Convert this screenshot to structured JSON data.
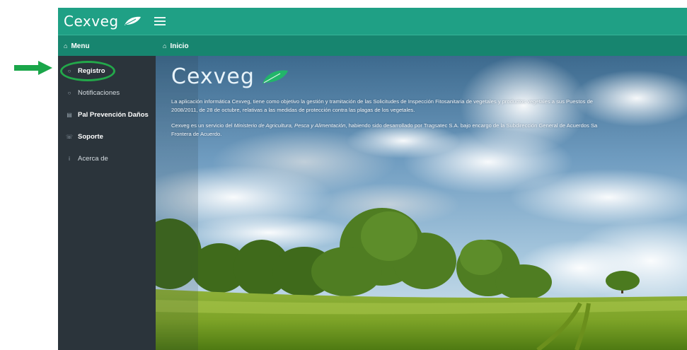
{
  "app": {
    "brand": "Cexveg"
  },
  "subbar": {
    "left_label": "Menu",
    "right_label": "Inicio"
  },
  "sidebar": {
    "items": [
      {
        "label": "Registro",
        "icon": "circle-icon",
        "active": true
      },
      {
        "label": "Notificaciones",
        "icon": "circle-icon"
      },
      {
        "label": "Pal Prevención Daños",
        "icon": "chart-icon"
      },
      {
        "label": "Soporte",
        "icon": "phone-icon"
      },
      {
        "label": "Acerca de",
        "icon": "info-icon"
      }
    ]
  },
  "content": {
    "logo_text": "Cexveg",
    "paragraph1_line1": "La aplicación informática Cexveg, tiene como objetivo la gestión y tramitación de las Solicitudes de Inspección Fitosanitaria de vegetales y productos vegetales a sus Puestos de",
    "paragraph1_line2": "2008/2011, de 28 de octubre, relativas a las medidas de protección contra las plagas de los vegetales.",
    "paragraph2_line1_a": "Cexveg es un servicio del ",
    "paragraph2_line1_em": "Ministerio de Agricultura, Pesca y Alimentación",
    "paragraph2_line1_b": ", habiendo sido desarrollado por Tragsatec S.A. bajo encargo de la Subdirección General de Acuerdos Sa",
    "paragraph2_line2": "Frontera de Acuerdo."
  },
  "colors": {
    "topbar": "#1fa085",
    "subbar": "#17856f",
    "sidebar": "#2b343b",
    "highlight": "#23a84a"
  }
}
